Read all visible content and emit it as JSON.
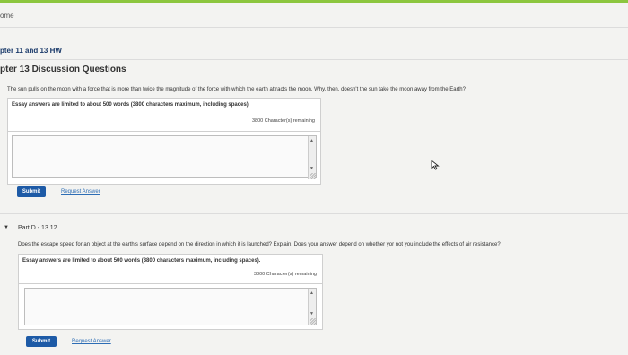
{
  "header": {
    "home_label": "ome",
    "breadcrumb": "pter 11 and 13 HW",
    "section_title": "pter 13 Discussion Questions"
  },
  "q1": {
    "question": "The sun pulls on the moon with a force that is more than twice the magnitude of the force with which the earth attracts the moon. Why, then, doesn't the sun take the moon away from the Earth?",
    "notice": "Essay answers are limited to about 500 words (3800 characters maximum, including spaces).",
    "remaining": "3800 Character(s) remaining",
    "answer_value": "",
    "submit_label": "Submit",
    "request_label": "Request Answer"
  },
  "part_d": {
    "label": "Part D - 13.12",
    "question": "Does the escape speed for an object at the earth's surface depend on the direction in which it is launched? Explain. Does your answer depend on whether yor not you include the effects of air resistance?",
    "notice": "Essay answers are limited to about 500 words (3800 characters maximum, including spaces).",
    "remaining": "3800 Character(s) remaining",
    "answer_value": "",
    "submit_label": "Submit",
    "request_label": "Request Answer"
  },
  "icons": {
    "collapse": "caret-down-icon",
    "cursor": "mouse-cursor-icon",
    "scroll_up": "scroll-up-icon",
    "scroll_down": "scroll-down-icon",
    "resize": "resize-grip-icon"
  },
  "colors": {
    "accent_bar": "#8cc63f",
    "submit_bg": "#1d5aa6",
    "link": "#2d6db5"
  }
}
